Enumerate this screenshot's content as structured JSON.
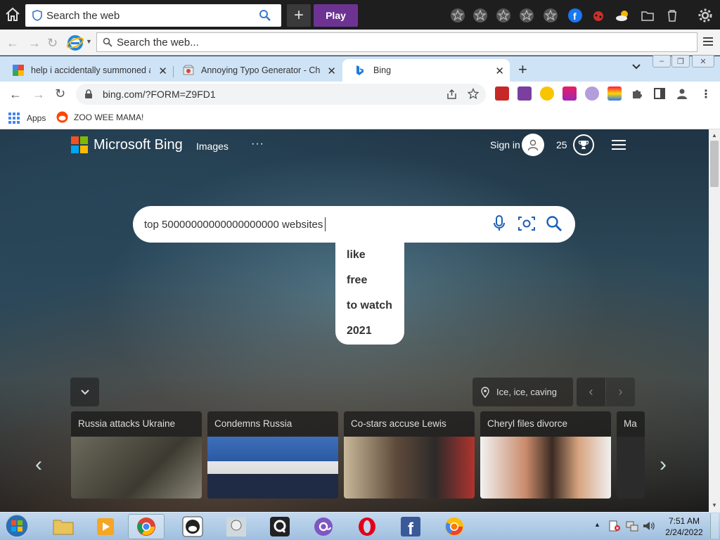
{
  "topbar": {
    "search_placeholder": "Search the web",
    "plus_label": "+",
    "play_label": "Play"
  },
  "ie": {
    "address_placeholder": "Search the web..."
  },
  "tabs": [
    {
      "title": "help i accidentally summoned a m",
      "favicon": "google-icon"
    },
    {
      "title": "Annoying Typo Generator - Chro",
      "favicon": "chrome-webstore-icon"
    },
    {
      "title": "Bing",
      "favicon": "bing-icon"
    }
  ],
  "omnibox": {
    "url": "bing.com/?FORM=Z9FD1"
  },
  "bookmarks": {
    "apps_label": "Apps",
    "item1": "ZOO WEE MAMA!"
  },
  "bing": {
    "brand": "Microsoft Bing",
    "nav_images": "Images",
    "nav_more": "···",
    "sign_in": "Sign in",
    "points": "25",
    "search_query": "top 50000000000000000000 websites",
    "suggestions": [
      "like",
      "free",
      "to watch",
      "2021"
    ],
    "location": "Ice, ice, caving",
    "cards": [
      {
        "title": "Russia attacks Ukraine"
      },
      {
        "title": "Condemns Russia"
      },
      {
        "title": "Co-stars accuse Lewis"
      },
      {
        "title": "Cheryl files divorce"
      },
      {
        "title": "Ma"
      }
    ]
  },
  "taskbar": {
    "apps": [
      "windows-explorer",
      "media-player",
      "chrome",
      "app-face",
      "app-character",
      "app-q",
      "app-at",
      "opera",
      "facebook",
      "chrome-canary"
    ],
    "time": "7:51 AM",
    "date": "2/24/2022"
  },
  "colors": {
    "play_purple": "#6d3393",
    "tabstrip_blue": "#cfe3f6",
    "taskbar_blue": "#a9c7e6"
  }
}
